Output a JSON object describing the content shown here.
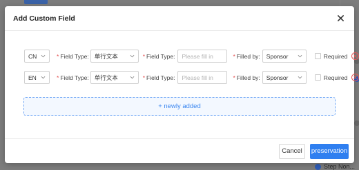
{
  "modal": {
    "title": "Add Custom Field",
    "rows": [
      {
        "language": "CN",
        "field_type_label": "Field Type:",
        "field_type_value": "单行文本",
        "field_name_label": "Field Type:",
        "field_name_value": "",
        "field_name_placeholder": "Please fill in",
        "filled_by_label": "Filled by:",
        "filled_by_value": "Sponsor",
        "required_label": "Required"
      },
      {
        "language": "EN",
        "field_type_label": "Field Type:",
        "field_type_value": "单行文本",
        "field_name_label": "Field Type:",
        "field_name_value": "",
        "field_name_placeholder": "Please fill in",
        "filled_by_label": "Filled by:",
        "filled_by_value": "Sponsor",
        "required_label": "Required"
      }
    ],
    "add_button_label": "+ newly added",
    "footer": {
      "cancel_label": "Cancel",
      "confirm_label": "preservation"
    }
  },
  "background": {
    "step_label": "Step Non..."
  },
  "colors": {
    "primary": "#2f7ff0",
    "danger": "#e65555",
    "required_asterisk": "#e34d4d",
    "add_border": "#6fa6f5"
  },
  "icons": {
    "close": "close-icon",
    "chevron": "chevron-down-icon",
    "remove": "remove-circle-icon"
  }
}
